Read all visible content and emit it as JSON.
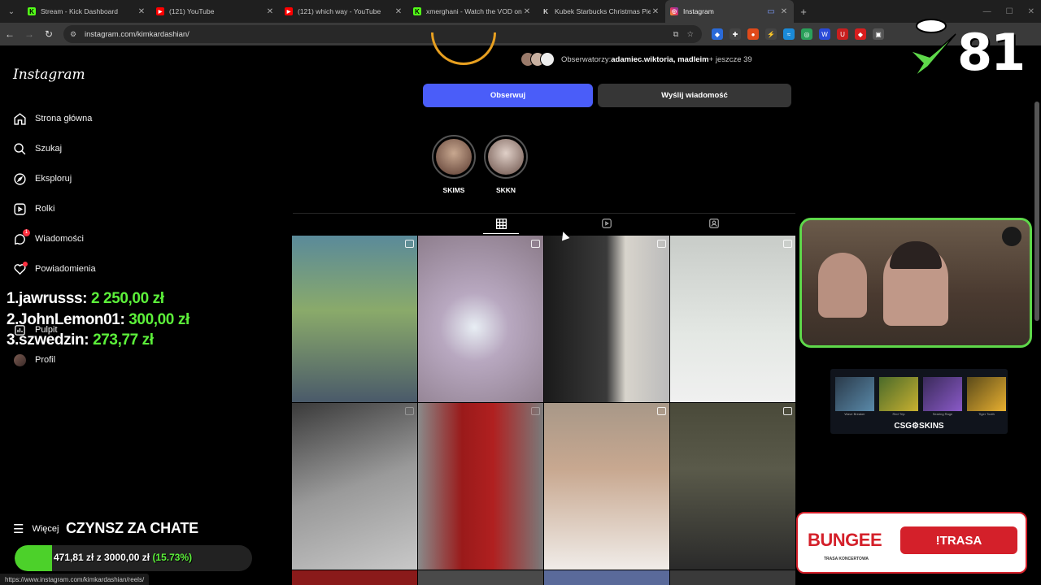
{
  "browser": {
    "tabs": [
      {
        "title": "Stream - Kick Dashboard",
        "favicon_color": "#53fc18",
        "favicon_char": "K"
      },
      {
        "title": "(121) YouTube",
        "favicon_color": "#ff0000",
        "favicon_char": "▶"
      },
      {
        "title": "(121) which way - YouTube",
        "favicon_color": "#ff0000",
        "favicon_char": "▶"
      },
      {
        "title": "xmerghani - Watch the VOD on",
        "favicon_color": "#53fc18",
        "favicon_char": "K"
      },
      {
        "title": "Kubek Starbucks Christmas Pier",
        "favicon_color": "#333333",
        "favicon_char": "K"
      },
      {
        "title": "Instagram",
        "favicon_color": "#e1306c",
        "favicon_char": "◎"
      }
    ],
    "url": "instagram.com/kimkardashian/",
    "status_url": "https://www.instagram.com/kimkardashian/reels/"
  },
  "sidebar": {
    "logo": "Instagram",
    "items": [
      {
        "label": "Strona główna",
        "icon": "home-icon"
      },
      {
        "label": "Szukaj",
        "icon": "search-icon"
      },
      {
        "label": "Eksploruj",
        "icon": "compass-icon"
      },
      {
        "label": "Rolki",
        "icon": "reels-icon"
      },
      {
        "label": "Wiadomości",
        "icon": "messenger-icon",
        "badge": "1"
      },
      {
        "label": "Powiadomienia",
        "icon": "heart-icon"
      },
      {
        "label": "Pulpit",
        "icon": "dashboard-icon"
      },
      {
        "label": "Profil",
        "icon": "avatar"
      }
    ],
    "more": "Więcej"
  },
  "profile": {
    "followers_prefix": "Obserwatorzy: ",
    "followers_names": "adamiec.wiktoria, madleim",
    "followers_suffix": " + jeszcze 39",
    "follow_button": "Obserwuj",
    "message_button": "Wyślij wiadomość",
    "highlights": [
      {
        "label": "SKIMS",
        "color": "#8a6a5a"
      },
      {
        "label": "SKKN",
        "color": "#6a5048"
      }
    ],
    "post_colors": [
      [
        "#4a7a8a",
        "#b8a8b0",
        "#2a2a2a",
        "#d8dcd8"
      ],
      [
        "#8a8a8a",
        "#7a1a1a",
        "#c8b8a8",
        "#3a4a3a"
      ]
    ]
  },
  "overlay": {
    "donors": [
      {
        "name": "1.jawrusss:",
        "amount": "2 250,00 zł"
      },
      {
        "name": "2.JohnLemon01:",
        "amount": "300,00 zł"
      },
      {
        "name": "3.szwedzin:",
        "amount": "273,77 zł"
      }
    ],
    "goal_title": "CZYNSZ ZA CHATE",
    "goal_current": "471,81 zł",
    "goal_sep": " z ",
    "goal_target": "3000,00 zł",
    "goal_percent": "(15.73%)",
    "goal_fraction": 0.1573,
    "counter": "81",
    "csg_label": "CSG⚙SKINS",
    "csg_items": [
      "Wave Breaker",
      "Red Trip",
      "Searing Rage",
      "Tiger Tooth"
    ],
    "bungee_title": "BUNGEE",
    "bungee_sub": "TRASA KONCERTOWA",
    "bungee_button": "!TRASA"
  }
}
